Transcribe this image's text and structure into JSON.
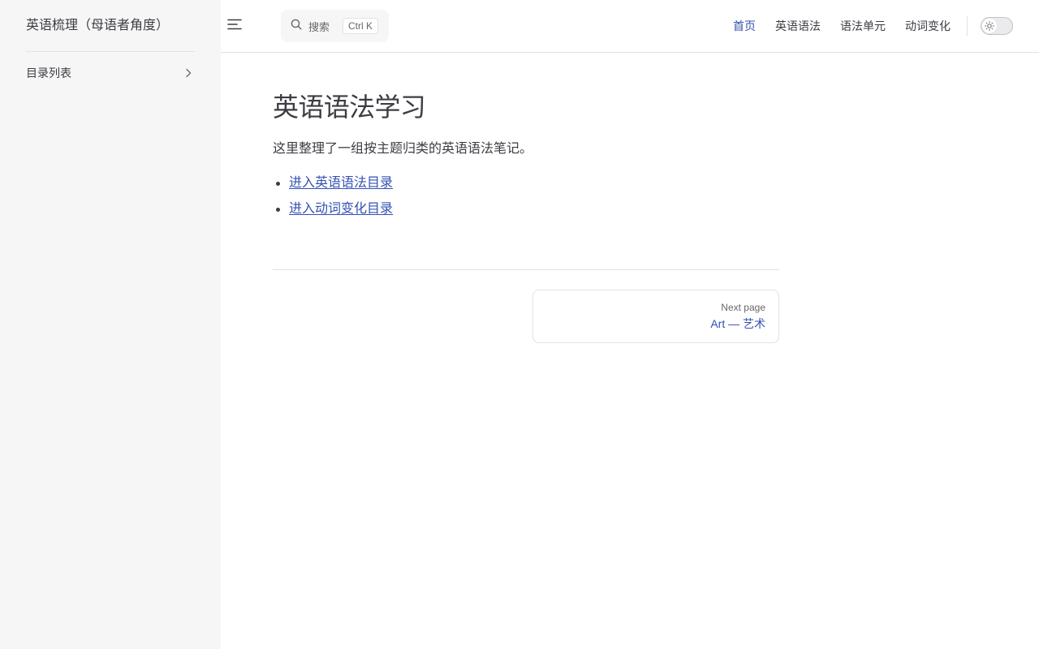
{
  "site": {
    "title": "英语梳理（母语者角度）"
  },
  "sidebar": {
    "items": [
      {
        "label": "目录列表",
        "icon": "chevron-right-icon"
      }
    ]
  },
  "navbar": {
    "search": {
      "label": "搜索",
      "shortcut": "Ctrl K",
      "icon": "search-icon"
    },
    "links": [
      {
        "label": "首页",
        "active": true
      },
      {
        "label": "英语语法",
        "active": false
      },
      {
        "label": "语法单元",
        "active": false
      },
      {
        "label": "动词变化",
        "active": false
      }
    ],
    "theme_toggle": {
      "icon": "sun-icon",
      "mode": "light"
    }
  },
  "main": {
    "title": "英语语法学习",
    "lead": "这里整理了一组按主题归类的英语语法笔记。",
    "links": [
      {
        "label": "进入英语语法目录"
      },
      {
        "label": "进入动词变化目录"
      }
    ]
  },
  "pager": {
    "next_label": "Next page",
    "next_title": "Art — 艺术"
  },
  "colors": {
    "brand": "#3451b2",
    "text": "#3c3c43",
    "sidebar_bg": "#f6f6f7",
    "divider": "#e2e2e3"
  }
}
